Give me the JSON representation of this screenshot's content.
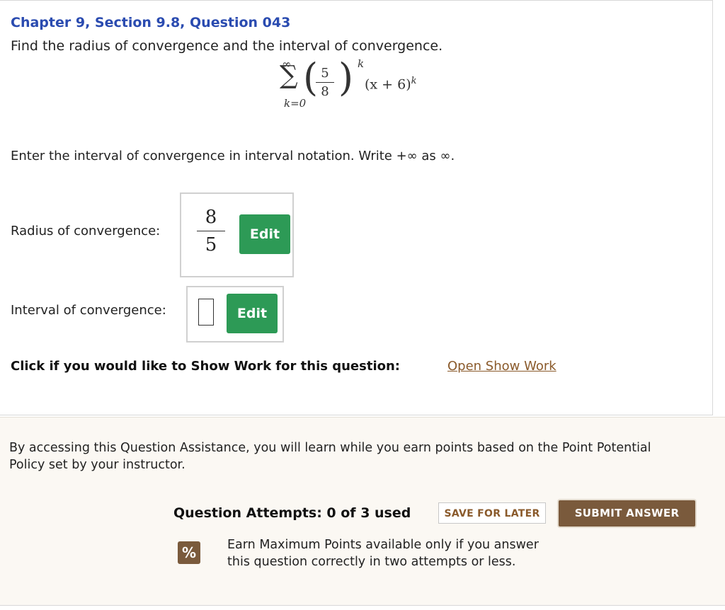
{
  "question": {
    "chapter_title": "Chapter 9, Section 9.8, Question 043",
    "prompt": "Find the radius of convergence and the interval of convergence.",
    "series": {
      "sigma": "∑",
      "upper_limit": "∞",
      "lower_limit": "k=0",
      "fraction_numerator": "5",
      "fraction_denominator": "8",
      "outer_exponent": "k",
      "term": "(x + 6)",
      "term_exponent": "k"
    },
    "instructions": "Enter the interval of convergence in interval notation. Write +∞ as ∞."
  },
  "answers": {
    "radius_label": "Radius of convergence:",
    "radius_numerator": "8",
    "radius_denominator": "5",
    "interval_label": "Interval of convergence:",
    "edit_label": "Edit"
  },
  "show_work": {
    "label": "Click if you would like to Show Work for this question:",
    "link": "Open Show Work"
  },
  "assistance": {
    "text": "By accessing this Question Assistance, you will learn while you earn points based on the Point Potential Policy set by your instructor.",
    "attempts": "Question Attempts: 0 of 3 used",
    "save_label": "SAVE FOR LATER",
    "submit_label": "SUBMIT ANSWER",
    "percent_symbol": "%",
    "earn_text": "Earn Maximum Points available only if you answer this question correctly in two attempts or less."
  },
  "colors": {
    "title_blue": "#2a4bb0",
    "edit_green": "#2d9a56",
    "brown_accent": "#7a5a3c",
    "link_brown": "#8a5a2b"
  },
  "icons": {
    "percent_icon": "percent-icon"
  }
}
